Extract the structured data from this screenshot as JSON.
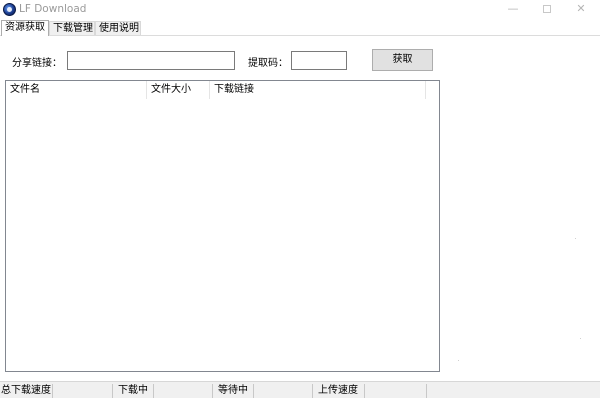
{
  "window": {
    "title": "LF Download",
    "minimize_glyph": "—",
    "close_glyph": "✕"
  },
  "tabs": [
    {
      "label": "资源获取",
      "active": true
    },
    {
      "label": "下载管理",
      "active": false
    },
    {
      "label": "使用说明",
      "active": false
    }
  ],
  "form": {
    "share_link_label": "分享链接：",
    "share_link_value": "",
    "extract_code_label": "提取码：",
    "extract_code_value": "",
    "fetch_button_label": "获取"
  },
  "file_list": {
    "columns": [
      "文件名",
      "文件大小",
      "下载链接"
    ],
    "rows": []
  },
  "status_bar": {
    "total_speed_label": "总下载速度",
    "downloading_label": "下载中",
    "waiting_label": "等待中",
    "upload_speed_label": "上传速度"
  },
  "icons": {
    "app": "lf-download-app-icon"
  }
}
